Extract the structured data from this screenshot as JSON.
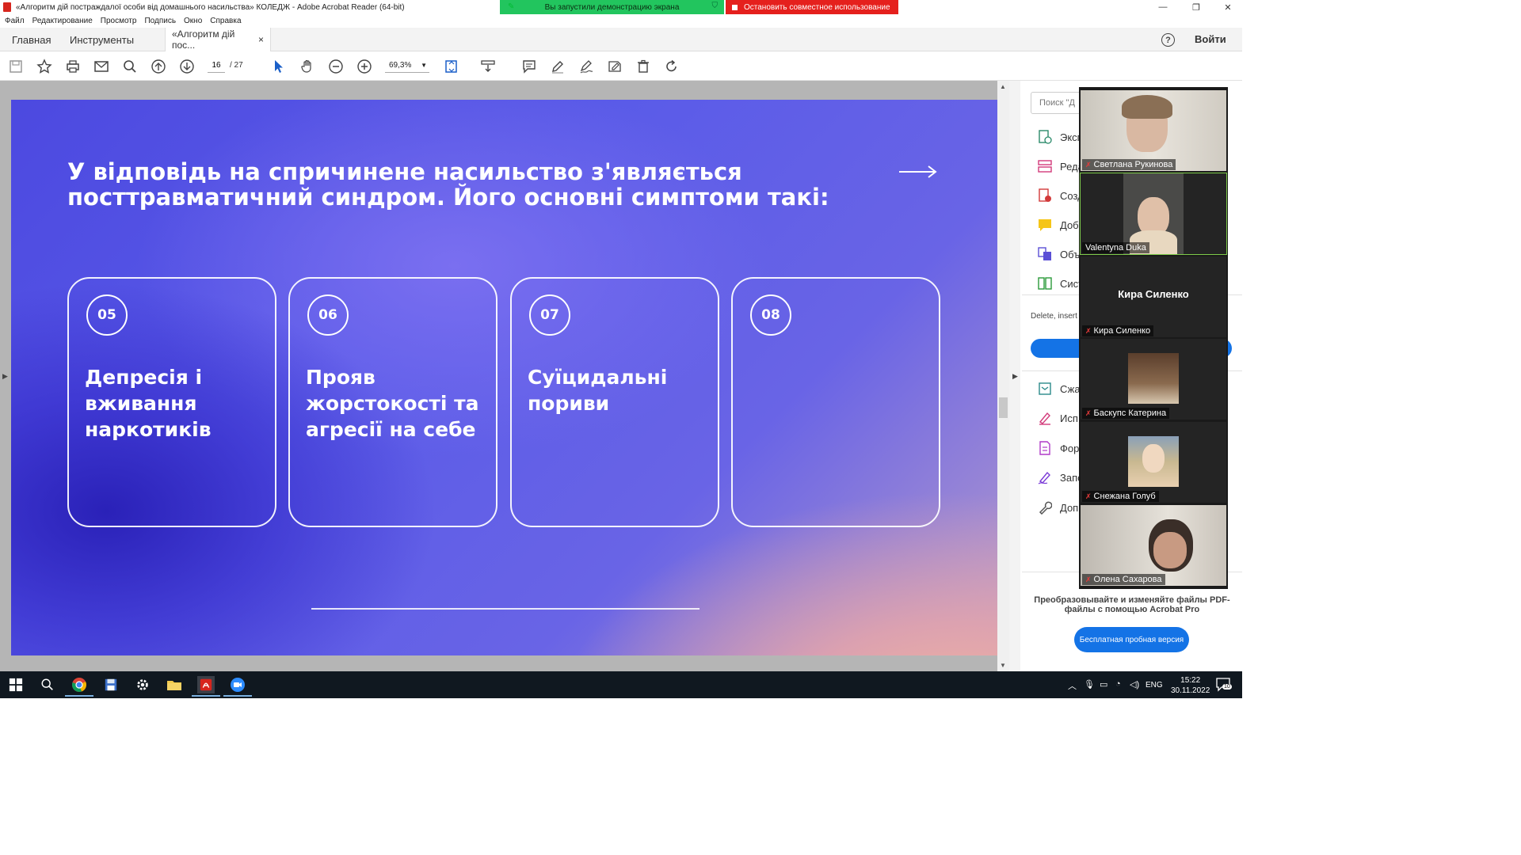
{
  "window": {
    "title": "«Алгоритм дій постраждалої особи від домашнього насильства» КОЛЕДЖ - Adobe Acrobat Reader (64-bit)",
    "share_banner": "Вы запустили демонстрацию экрана",
    "stop_share": "Остановить совместное использование"
  },
  "menu": [
    "Файл",
    "Редактирование",
    "Просмотр",
    "Подпись",
    "Окно",
    "Справка"
  ],
  "tabs": {
    "home": "Главная",
    "tools": "Инструменты",
    "doc": "«Алгоритм дій пос...",
    "close": "×",
    "signin": "Войти",
    "help": "?"
  },
  "toolbar": {
    "page_current": "16",
    "page_total": "/  27",
    "zoom": "69,3%"
  },
  "slide": {
    "title": "У відповідь на спричинене насильство з'являється посттравматичний синдром. Його основні симптоми такі:",
    "cards": [
      {
        "num": "05",
        "text": "Депресія і вживання наркотиків"
      },
      {
        "num": "06",
        "text": "Прояв жорстокості та агресії на себе"
      },
      {
        "num": "07",
        "text": "Суїцидальні пориви"
      },
      {
        "num": "08",
        "text": ""
      }
    ]
  },
  "right_panel": {
    "search_placeholder": "Поиск \"Д",
    "tools": [
      "Эксп",
      "Реда",
      "Созд",
      "Доб",
      "Объ",
      "Сист"
    ],
    "tools2": [
      "Сжа",
      "Исп",
      "Фор",
      "Запо",
      "Доп"
    ],
    "description": "Delete, insert",
    "promo": "Преобразовывайте и изменяйте файлы PDF-файлы с помощью Acrobat Pro",
    "trial_button": "Бесплатная пробная версия"
  },
  "participants": [
    {
      "name": "Светлана Рукинова",
      "muted": true
    },
    {
      "name": "Valentyna Duka",
      "muted": false
    },
    {
      "name": "Кира Силенко",
      "muted": true,
      "big_name": "Кира Силенко"
    },
    {
      "name": "Баскупс Катерина",
      "muted": true
    },
    {
      "name": "Снежана Голуб",
      "muted": true
    },
    {
      "name": "Олена Сахарова",
      "muted": true
    }
  ],
  "taskbar": {
    "lang": "ENG",
    "time": "15:22",
    "date": "30.11.2022",
    "notifications": "10"
  },
  "colors": {
    "acrobat_red": "#d7261e",
    "share_green": "#22c55e",
    "stop_red": "#e5201d",
    "acrobat_blue": "#1473e6",
    "slide_purple": "#5a5be8"
  }
}
